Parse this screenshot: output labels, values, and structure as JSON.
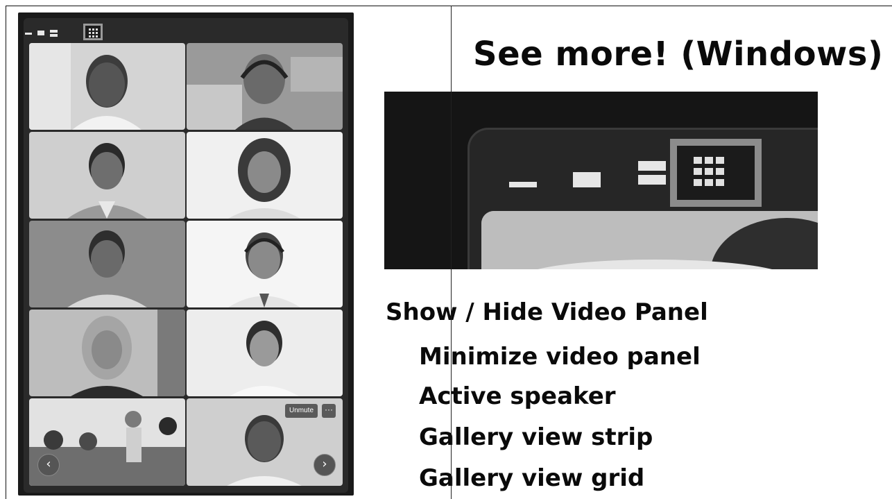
{
  "slide": {
    "title": "See more! (Windows)"
  },
  "video_panel": {
    "toolbar_icons": [
      "minimize-icon",
      "active-speaker-icon",
      "gallery-strip-icon",
      "gallery-grid-icon"
    ],
    "selected_view": "gallery-grid-icon",
    "tiles": [
      {
        "name": "participant-tile"
      },
      {
        "name": "participant-tile"
      },
      {
        "name": "participant-tile"
      },
      {
        "name": "participant-tile"
      },
      {
        "name": "participant-tile"
      },
      {
        "name": "participant-tile"
      },
      {
        "name": "participant-tile"
      },
      {
        "name": "participant-tile"
      },
      {
        "name": "participant-tile"
      },
      {
        "name": "participant-tile"
      }
    ],
    "unmute_label": "Unmute",
    "more_label": "···",
    "prev_label": "‹",
    "next_label": "›"
  },
  "menu": {
    "heading": "Show / Hide Video Panel",
    "items": [
      "Minimize video panel",
      "Active speaker",
      "Gallery view strip",
      "Gallery view grid"
    ]
  },
  "colors": {
    "panel_bg": "#1a1a1a",
    "selected_outline": "#9a9a9a",
    "text": "#0a0a0a"
  }
}
